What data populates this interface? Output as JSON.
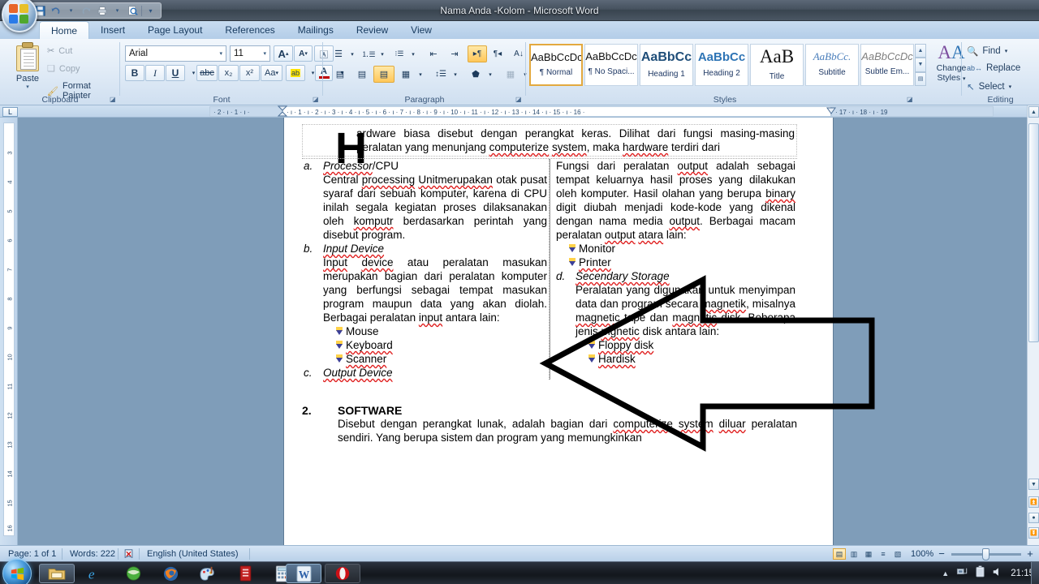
{
  "window": {
    "title": "Nama Anda -Kolom - Microsoft Word",
    "orb_icon": "office-orb-icon"
  },
  "quick_access": {
    "save": "save-icon",
    "undo": "undo-icon",
    "redo": "redo-icon",
    "print_preview": "print-preview-icon",
    "quick_print": "quick-print-icon",
    "customize": "chevron-down-icon"
  },
  "tabs": [
    {
      "label": "Home",
      "active": true
    },
    {
      "label": "Insert",
      "active": false
    },
    {
      "label": "Page Layout",
      "active": false
    },
    {
      "label": "References",
      "active": false
    },
    {
      "label": "Mailings",
      "active": false
    },
    {
      "label": "Review",
      "active": false
    },
    {
      "label": "View",
      "active": false
    }
  ],
  "ribbon": {
    "clipboard": {
      "label": "Clipboard",
      "paste": "Paste",
      "cut": "Cut",
      "copy": "Copy",
      "format_painter": "Format Painter"
    },
    "font": {
      "label": "Font",
      "font_name": "Arial",
      "font_size": "11",
      "grow_font": "A",
      "shrink_font": "A",
      "clear_formatting": "clear-formatting-icon",
      "bold": "B",
      "italic": "I",
      "underline": "U",
      "strikethrough": "abc",
      "subscript": "x₂",
      "superscript": "x²",
      "change_case": "Aa",
      "highlight": "ab",
      "font_color": "A"
    },
    "paragraph": {
      "label": "Paragraph",
      "bullets": "bullets-icon",
      "numbering": "numbering-icon",
      "multilevel": "multilevel-list-icon",
      "decrease_indent": "decrease-indent-icon",
      "increase_indent": "increase-indent-icon",
      "ltr": "left-to-right-icon",
      "rtl": "right-to-left-icon",
      "sort": "sort-icon",
      "show_marks": "pilcrow-icon",
      "align_left": "align-left-icon",
      "align_center": "align-center-icon",
      "align_right": "align-right-icon",
      "justify": "justify-icon",
      "line_spacing": "line-spacing-icon",
      "shading": "shading-icon",
      "borders": "borders-icon"
    },
    "styles": {
      "label": "Styles",
      "items": [
        {
          "sample": "AaBbCcDc",
          "name": "¶ Normal",
          "selected": true
        },
        {
          "sample": "AaBbCcDc",
          "name": "¶ No Spaci...",
          "selected": false
        },
        {
          "sample": "AaBbCᴄ",
          "name": "Heading 1",
          "selected": false
        },
        {
          "sample": "AaBbCc",
          "name": "Heading 2",
          "selected": false
        },
        {
          "sample": "AaB",
          "name": "Title",
          "selected": false
        },
        {
          "sample": "AaBbCc.",
          "name": "Subtitle",
          "selected": false
        },
        {
          "sample": "AaBbCcDc",
          "name": "Subtle Em...",
          "selected": false
        }
      ],
      "change_styles": "Change\nStyles"
    },
    "editing": {
      "label": "Editing",
      "find": "Find",
      "replace": "Replace",
      "select": "Select"
    }
  },
  "ruler": {
    "corner_tab": "L",
    "horizontal_ticks": "· 2 · ı · 1 · ı ·",
    "horizontal_main": "· ı · 1 · ı · 2 · ı · 3 · ı · 4 · ı · 5 · ı · 6 · ı · 7 · ı · 8 · ı · 9 · ı · 10 · ı · 11 · ı · 12 · ı · 13 · ı · 14 · ı · 15 · ı · 16 ·",
    "horizontal_tail": "· 17 ·  ı  · 18 ·  ı  · 19",
    "vertical_ticks": [
      "3",
      "4",
      "5",
      "6",
      "7",
      "8",
      "9",
      "10",
      "11",
      "12",
      "13",
      "14",
      "15",
      "16"
    ]
  },
  "document": {
    "dropcap": "H",
    "intro": "ardware biasa disebut dengan perangkat keras. Dilihat dari fungsi masing-masing peralatan yang menunjang computerize system,  maka hardware terdiri dari",
    "left_column": [
      {
        "type": "item",
        "mark": "a.",
        "title": "Processor/CPU",
        "title_plain": "/CPU",
        "title_italic": "Processor"
      },
      {
        "type": "para",
        "text": "Central processing Unitmerupakan otak pusat syaraf dari sebuah komputer, karena di CPU inilah segala kegiatan proses dilaksanakan oleh komputr berdasarkan perintah yang disebut program."
      },
      {
        "type": "item",
        "mark": "b.",
        "title": "Input Device",
        "title_italic": "Input Device",
        "title_plain": ""
      },
      {
        "type": "para",
        "text": "Input device atau peralatan masukan merupakan bagian dari peralatan komputer yang berfungsi sebagai tempat masukan program maupun data yang akan diolah. Berbagai peralatan input antara lain:"
      },
      {
        "type": "bullet",
        "text": "Mouse"
      },
      {
        "type": "bullet",
        "text": "Keyboard"
      },
      {
        "type": "bullet",
        "text": "Scanner"
      },
      {
        "type": "item",
        "mark": "c.",
        "title": "Output Device",
        "title_italic": "Output Device",
        "title_plain": ""
      }
    ],
    "right_column": [
      {
        "type": "para",
        "text": "Fungsi dari peralatan output adalah sebagai tempat keluarnya hasil proses yang dilakukan oleh komputer. Hasil olahan yang berupa binary digit diubah menjadi kode-kode yang dikenal dengan nama media output. Berbagai macam peralatan output atara lain:"
      },
      {
        "type": "bullet",
        "text": "Monitor"
      },
      {
        "type": "bullet",
        "text": "Printer"
      },
      {
        "type": "item",
        "mark": "d.",
        "title": "Secendary Storage",
        "title_italic": "Secendary Storage",
        "title_plain": ""
      },
      {
        "type": "para",
        "text": "Peralatan yang digunakan untuk menyimpan data dan program secara magnetik, misalnya magnetic tape dan magnetic disk. Beberapa jenis mgnetic disk antara lain:"
      },
      {
        "type": "bullet",
        "text": "Floppy disk"
      },
      {
        "type": "bullet",
        "text": "Hardisk"
      }
    ],
    "section2": {
      "number": "2.",
      "heading": "SOFTWARE",
      "body": "Disebut dengan perangkat lunak, adalah bagian dari computerize system diluar peralatan sendiri. Yang berupa sistem dan program yang memungkinkan"
    },
    "shape": "left-block-arrow-shape"
  },
  "status_bar": {
    "page": "Page: 1 of 1",
    "words": "Words: 222",
    "proofing_icon": "proofing-errors-icon",
    "language": "English (United States)",
    "views": [
      {
        "name": "print-layout-view",
        "glyph": "▤",
        "selected": true
      },
      {
        "name": "full-screen-reading-view",
        "glyph": "▥",
        "selected": false
      },
      {
        "name": "web-layout-view",
        "glyph": "▦",
        "selected": false
      },
      {
        "name": "outline-view",
        "glyph": "≡",
        "selected": false
      },
      {
        "name": "draft-view",
        "glyph": "▧",
        "selected": false
      }
    ],
    "zoom": "100%",
    "zoom_out": "−",
    "zoom_in": "+"
  },
  "taskbar": {
    "start": "windows-start-icon",
    "items": [
      {
        "name": "windows-explorer-icon",
        "active": false
      },
      {
        "name": "internet-explorer-icon",
        "active": false
      },
      {
        "name": "green-globe-icon",
        "active": false
      },
      {
        "name": "firefox-icon",
        "active": false
      },
      {
        "name": "paint-icon",
        "active": false
      },
      {
        "name": "red-app-icon",
        "active": false
      },
      {
        "name": "calculator-icon",
        "active": false
      },
      {
        "name": "microsoft-word-icon",
        "active": true
      },
      {
        "name": "opera-icon",
        "active": false
      }
    ],
    "tray": {
      "show_hidden": "chevron-up-icon",
      "network": "network-icon",
      "battery": "battery-icon",
      "volume": "volume-icon",
      "time": "21:15"
    }
  },
  "colors": {
    "accent": "#1f3c5e",
    "selected_style_border": "#e3a93f",
    "highlight": "#ffc75a"
  }
}
